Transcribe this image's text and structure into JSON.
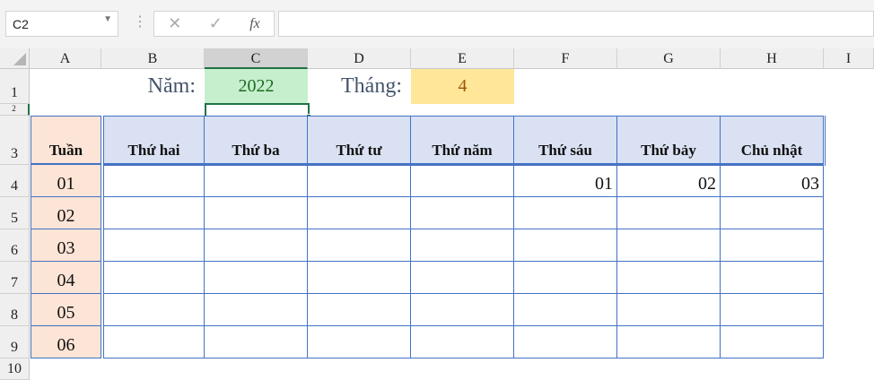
{
  "name_box": "C2",
  "formula_bar": {
    "cancel_icon": "✕",
    "enter_icon": "✓",
    "fx_label": "fx",
    "value": ""
  },
  "columns": [
    "A",
    "B",
    "C",
    "D",
    "E",
    "F",
    "G",
    "H",
    "I"
  ],
  "rows": [
    "1",
    "2",
    "3",
    "4",
    "5",
    "6",
    "7",
    "8",
    "9",
    "10"
  ],
  "selected_cell": "C2",
  "row1": {
    "year_label": "Năm:",
    "year_value": "2022",
    "month_label": "Tháng:",
    "month_value": "4"
  },
  "colors": {
    "year_fill": "#c6efce",
    "year_text": "#1e6b22",
    "month_fill": "#ffe699",
    "month_text": "#9c5700",
    "header_fill": "#d9e1f2",
    "week_fill": "#fce4d6",
    "border": "#4472c4"
  },
  "table": {
    "week_header": "Tuần",
    "day_headers": [
      "Thứ hai",
      "Thứ ba",
      "Thứ tư",
      "Thứ năm",
      "Thứ sáu",
      "Thứ bảy",
      "Chủ nhật"
    ],
    "weeks": [
      "01",
      "02",
      "03",
      "04",
      "05",
      "06"
    ],
    "days": [
      [
        "",
        "",
        "",
        "",
        "01",
        "02",
        "03"
      ],
      [
        "",
        "",
        "",
        "",
        "",
        "",
        ""
      ],
      [
        "",
        "",
        "",
        "",
        "",
        "",
        ""
      ],
      [
        "",
        "",
        "",
        "",
        "",
        "",
        ""
      ],
      [
        "",
        "",
        "",
        "",
        "",
        "",
        ""
      ],
      [
        "",
        "",
        "",
        "",
        "",
        "",
        ""
      ]
    ]
  }
}
